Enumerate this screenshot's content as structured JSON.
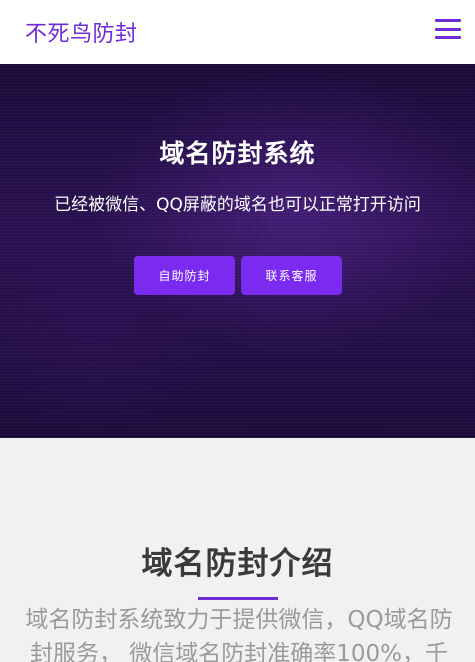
{
  "navbar": {
    "brand": "不死鸟防封",
    "menu_icon": "hamburger-menu-icon"
  },
  "hero": {
    "title": "域名防封系统",
    "subtitle": "已经被微信、QQ屏蔽的域名也可以正常打开访问",
    "buttons": [
      {
        "label": "自助防封"
      },
      {
        "label": "联系客服"
      }
    ]
  },
  "intro": {
    "title": "域名防封介绍",
    "text": "域名防封系统致力于提供微信，QQ域名防封服务， 微信域名防封准确率100%，千"
  },
  "colors": {
    "accent": "#6f2bd4",
    "button": "#7b2bf0",
    "hero_bg": "#2a1152",
    "section_bg": "#f1f1f1"
  }
}
